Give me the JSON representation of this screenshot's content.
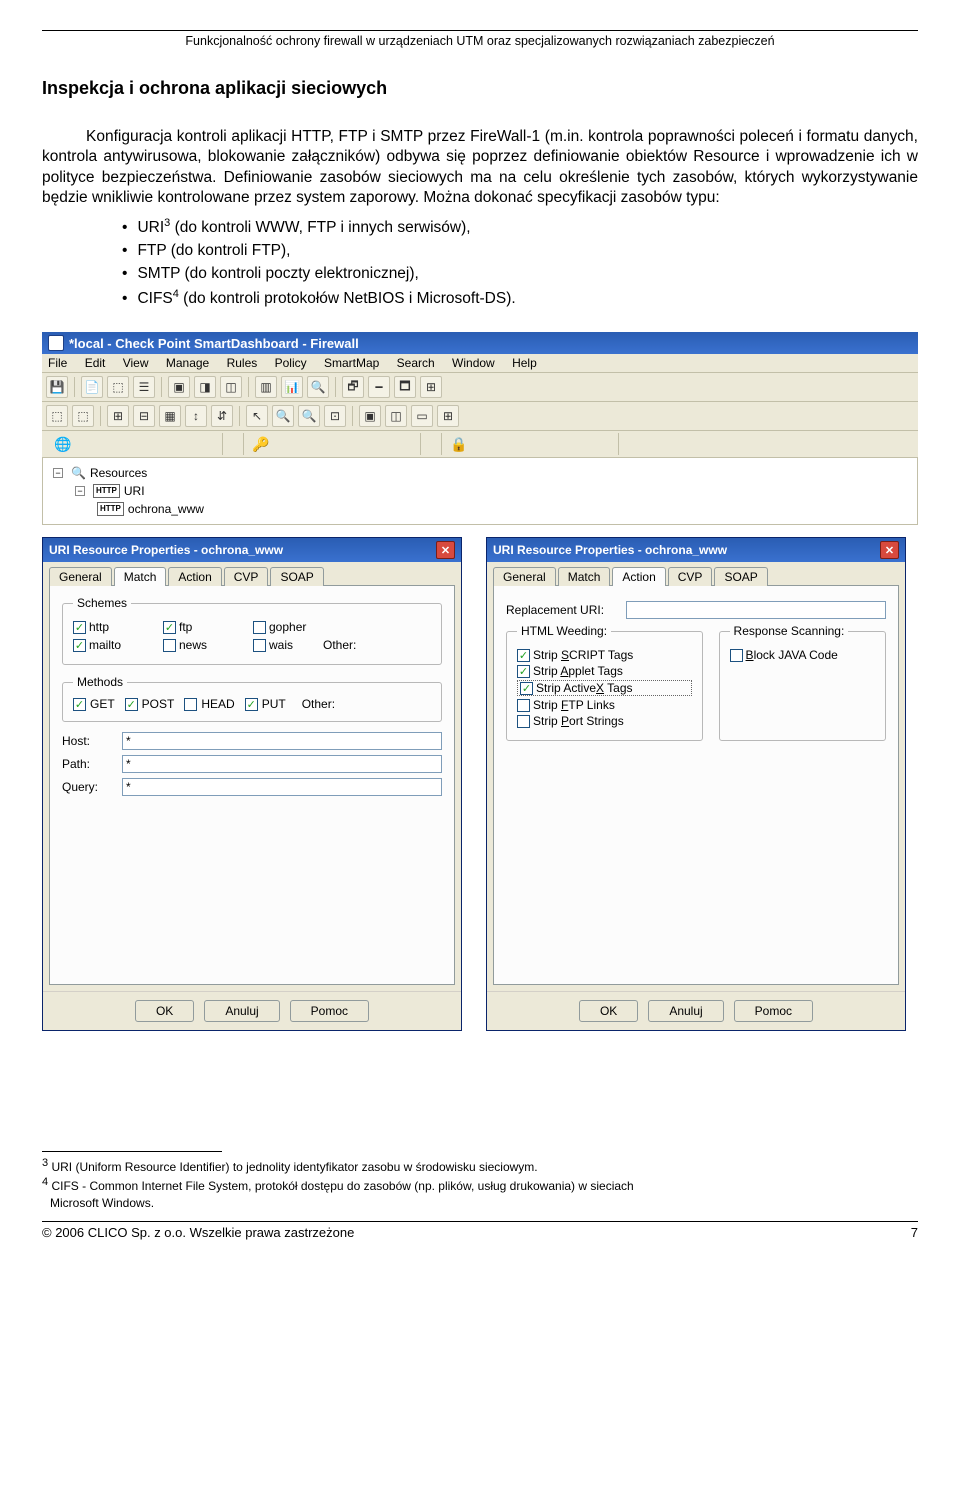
{
  "header": "Funkcjonalność ochrony firewall w urządzeniach UTM oraz specjalizowanych rozwiązaniach zabezpieczeń",
  "section_title": "Inspekcja i ochrona aplikacji sieciowych",
  "p1": "Konfiguracja kontroli aplikacji HTTP, FTP i SMTP przez FireWall-1 (m.in. kontrola poprawności poleceń i formatu danych, kontrola antywirusowa, blokowanie załączników) odbywa się poprzez definiowanie obiektów Resource i wprowadzenie ich w polityce bezpieczeństwa. Definiowanie zasobów sieciowych ma na celu określenie tych zasobów, których wykorzystywanie będzie wnikliwie kontrolowane przez system zaporowy. Można dokonać specyfikacji zasobów typu:",
  "bullets": {
    "b1_pre": "URI",
    "b1_sup": "3",
    "b1_post": "  (do kontroli WWW, FTP i innych serwisów),",
    "b2": "FTP  (do kontroli FTP),",
    "b3": "SMTP  (do kontroli poczty elektronicznej),",
    "b4_pre": "CIFS",
    "b4_sup": "4",
    "b4_post": " (do kontroli protokołów NetBIOS i Microsoft-DS)."
  },
  "app": {
    "title": "*local - Check Point SmartDashboard - Firewall",
    "menu": [
      "File",
      "Edit",
      "View",
      "Manage",
      "Rules",
      "Policy",
      "SmartMap",
      "Search",
      "Window",
      "Help"
    ],
    "tree": {
      "root": "Resources",
      "n1": "URI",
      "n2": "ochrona_www"
    }
  },
  "dialog": {
    "title": "URI Resource Properties - ochrona_www",
    "tabs": [
      "General",
      "Match",
      "Action",
      "CVP",
      "SOAP"
    ],
    "buttons": {
      "ok": "OK",
      "cancel": "Anuluj",
      "help": "Pomoc"
    }
  },
  "d1": {
    "active_tab": "Match",
    "schemes": {
      "legend": "Schemes",
      "items": [
        {
          "label": "http",
          "checked": true
        },
        {
          "label": "ftp",
          "checked": true
        },
        {
          "label": "gopher",
          "checked": false
        },
        {
          "label": "mailto",
          "checked": true
        },
        {
          "label": "news",
          "checked": false
        },
        {
          "label": "wais",
          "checked": false
        }
      ],
      "other": "Other:"
    },
    "methods": {
      "legend": "Methods",
      "items": [
        {
          "label": "GET",
          "checked": true
        },
        {
          "label": "POST",
          "checked": true
        },
        {
          "label": "HEAD",
          "checked": false
        },
        {
          "label": "PUT",
          "checked": true
        }
      ],
      "other": "Other:"
    },
    "host": {
      "label": "Host:",
      "val": "*"
    },
    "path": {
      "label": "Path:",
      "val": "*"
    },
    "query": {
      "label": "Query:",
      "val": "*"
    }
  },
  "d2": {
    "active_tab": "Action",
    "repl": "Replacement URI:",
    "html_weeding": {
      "legend": "HTML Weeding:",
      "items": [
        {
          "label": "Strip SCRIPT Tags",
          "checked": true,
          "ul": "S"
        },
        {
          "label": "Strip Applet Tags",
          "checked": true,
          "ul": "A"
        },
        {
          "label": "Strip ActiveX Tags",
          "checked": true,
          "ul": "X"
        },
        {
          "label": "Strip FTP Links",
          "checked": false,
          "ul": "F"
        },
        {
          "label": "Strip Port Strings",
          "checked": false,
          "ul": "P"
        }
      ]
    },
    "resp_scan": {
      "legend": "Response Scanning:",
      "items": [
        {
          "label": "Block JAVA Code",
          "checked": false,
          "ul": "B"
        }
      ]
    }
  },
  "footnotes": {
    "f3": " URI (Uniform Resource Identifier) to jednolity identyfikator zasobu w środowisku sieciowym.",
    "f4a": " CIFS - Common Internet File System, protokół dostępu do zasobów (np. plików, usług drukowania) w sieciach",
    "f4b": "Microsoft Windows."
  },
  "footer": {
    "left": "© 2006 CLICO Sp. z o.o.  Wszelkie prawa zastrzeżone",
    "right": "7"
  }
}
